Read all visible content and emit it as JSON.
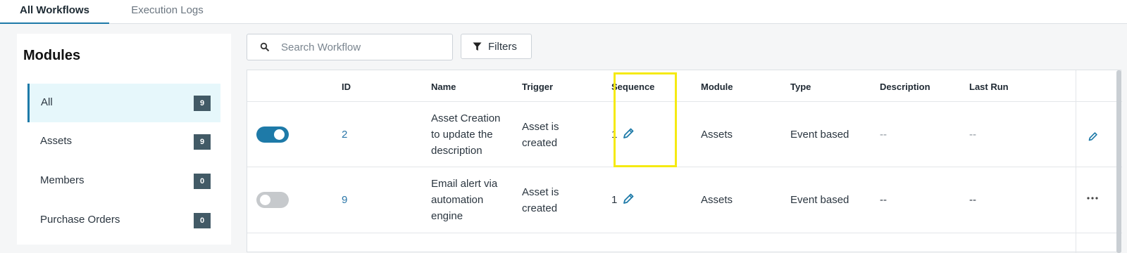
{
  "tabs": [
    {
      "label": "All Workflows",
      "active": true
    },
    {
      "label": "Execution Logs",
      "active": false
    }
  ],
  "sidebar": {
    "title": "Modules",
    "items": [
      {
        "label": "All",
        "count": "9",
        "active": true
      },
      {
        "label": "Assets",
        "count": "9",
        "active": false
      },
      {
        "label": "Members",
        "count": "0",
        "active": false
      },
      {
        "label": "Purchase Orders",
        "count": "0",
        "active": false
      }
    ]
  },
  "toolbar": {
    "search_placeholder": "Search Workflow",
    "filters_label": "Filters"
  },
  "table": {
    "headers": [
      "ID",
      "Name",
      "Trigger",
      "Sequence",
      "Module",
      "Type",
      "Description",
      "Last Run"
    ],
    "rows": [
      {
        "enabled": true,
        "id": "2",
        "name_lines": [
          "Asset Creation",
          "to update the",
          "description"
        ],
        "trigger_lines": [
          "Asset is",
          "created"
        ],
        "sequence": "1",
        "module": "Assets",
        "type": "Event based",
        "description": "--",
        "last_run": "--",
        "action_icon": "pencil-icon"
      },
      {
        "enabled": false,
        "id": "9",
        "name_lines": [
          "Email alert via",
          "automation",
          "engine"
        ],
        "trigger_lines": [
          "Asset is",
          "created"
        ],
        "sequence": "1",
        "module": "Assets",
        "type": "Event based",
        "description": "--",
        "last_run": "--",
        "action_icon": "more-horizontal-icon"
      }
    ]
  },
  "colors": {
    "accent": "#1e7aa8",
    "badge": "#425a66",
    "highlight": "#f5ea12",
    "active_bg": "#e6f7fb"
  }
}
